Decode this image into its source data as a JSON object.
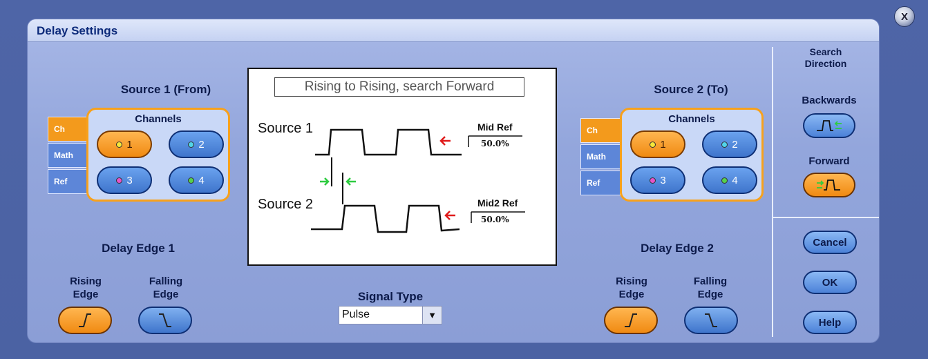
{
  "window": {
    "close_label": "X"
  },
  "dialog": {
    "title": "Delay Settings"
  },
  "source1": {
    "title": "Source 1 (From)",
    "tabs": [
      "Ch",
      "Math",
      "Ref"
    ],
    "channels_title": "Channels",
    "channels": [
      "1",
      "2",
      "3",
      "4"
    ],
    "channel_colors": [
      "#f6e83a",
      "#52d4e8",
      "#e654c8",
      "#56d04c"
    ]
  },
  "source2": {
    "title": "Source 2 (To)",
    "tabs": [
      "Ch",
      "Math",
      "Ref"
    ],
    "channels_title": "Channels",
    "channels": [
      "1",
      "2",
      "3",
      "4"
    ]
  },
  "edge1": {
    "title": "Delay Edge 1",
    "rising_label_1": "Rising",
    "rising_label_2": "Edge",
    "falling_label_1": "Falling",
    "falling_label_2": "Edge"
  },
  "edge2": {
    "title": "Delay Edge 2",
    "rising_label_1": "Rising",
    "rising_label_2": "Edge",
    "falling_label_1": "Falling",
    "falling_label_2": "Edge"
  },
  "preview": {
    "caption": "Rising to Rising, search Forward",
    "source1_label": "Source 1",
    "source2_label": "Source 2",
    "ref1_label": "Mid Ref",
    "ref1_value": "50.0%",
    "ref2_label": "Mid2 Ref",
    "ref2_value": "50.0%"
  },
  "signal_type": {
    "label": "Signal Type",
    "value": "Pulse"
  },
  "search": {
    "title_1": "Search",
    "title_2": "Direction",
    "backwards_label": "Backwards",
    "forward_label": "Forward"
  },
  "buttons": {
    "cancel": "Cancel",
    "ok": "OK",
    "help": "Help"
  },
  "colors": {
    "accent": "#f39a1c",
    "button_blue": "#4c82d8",
    "title_text": "#0c2a7a"
  }
}
